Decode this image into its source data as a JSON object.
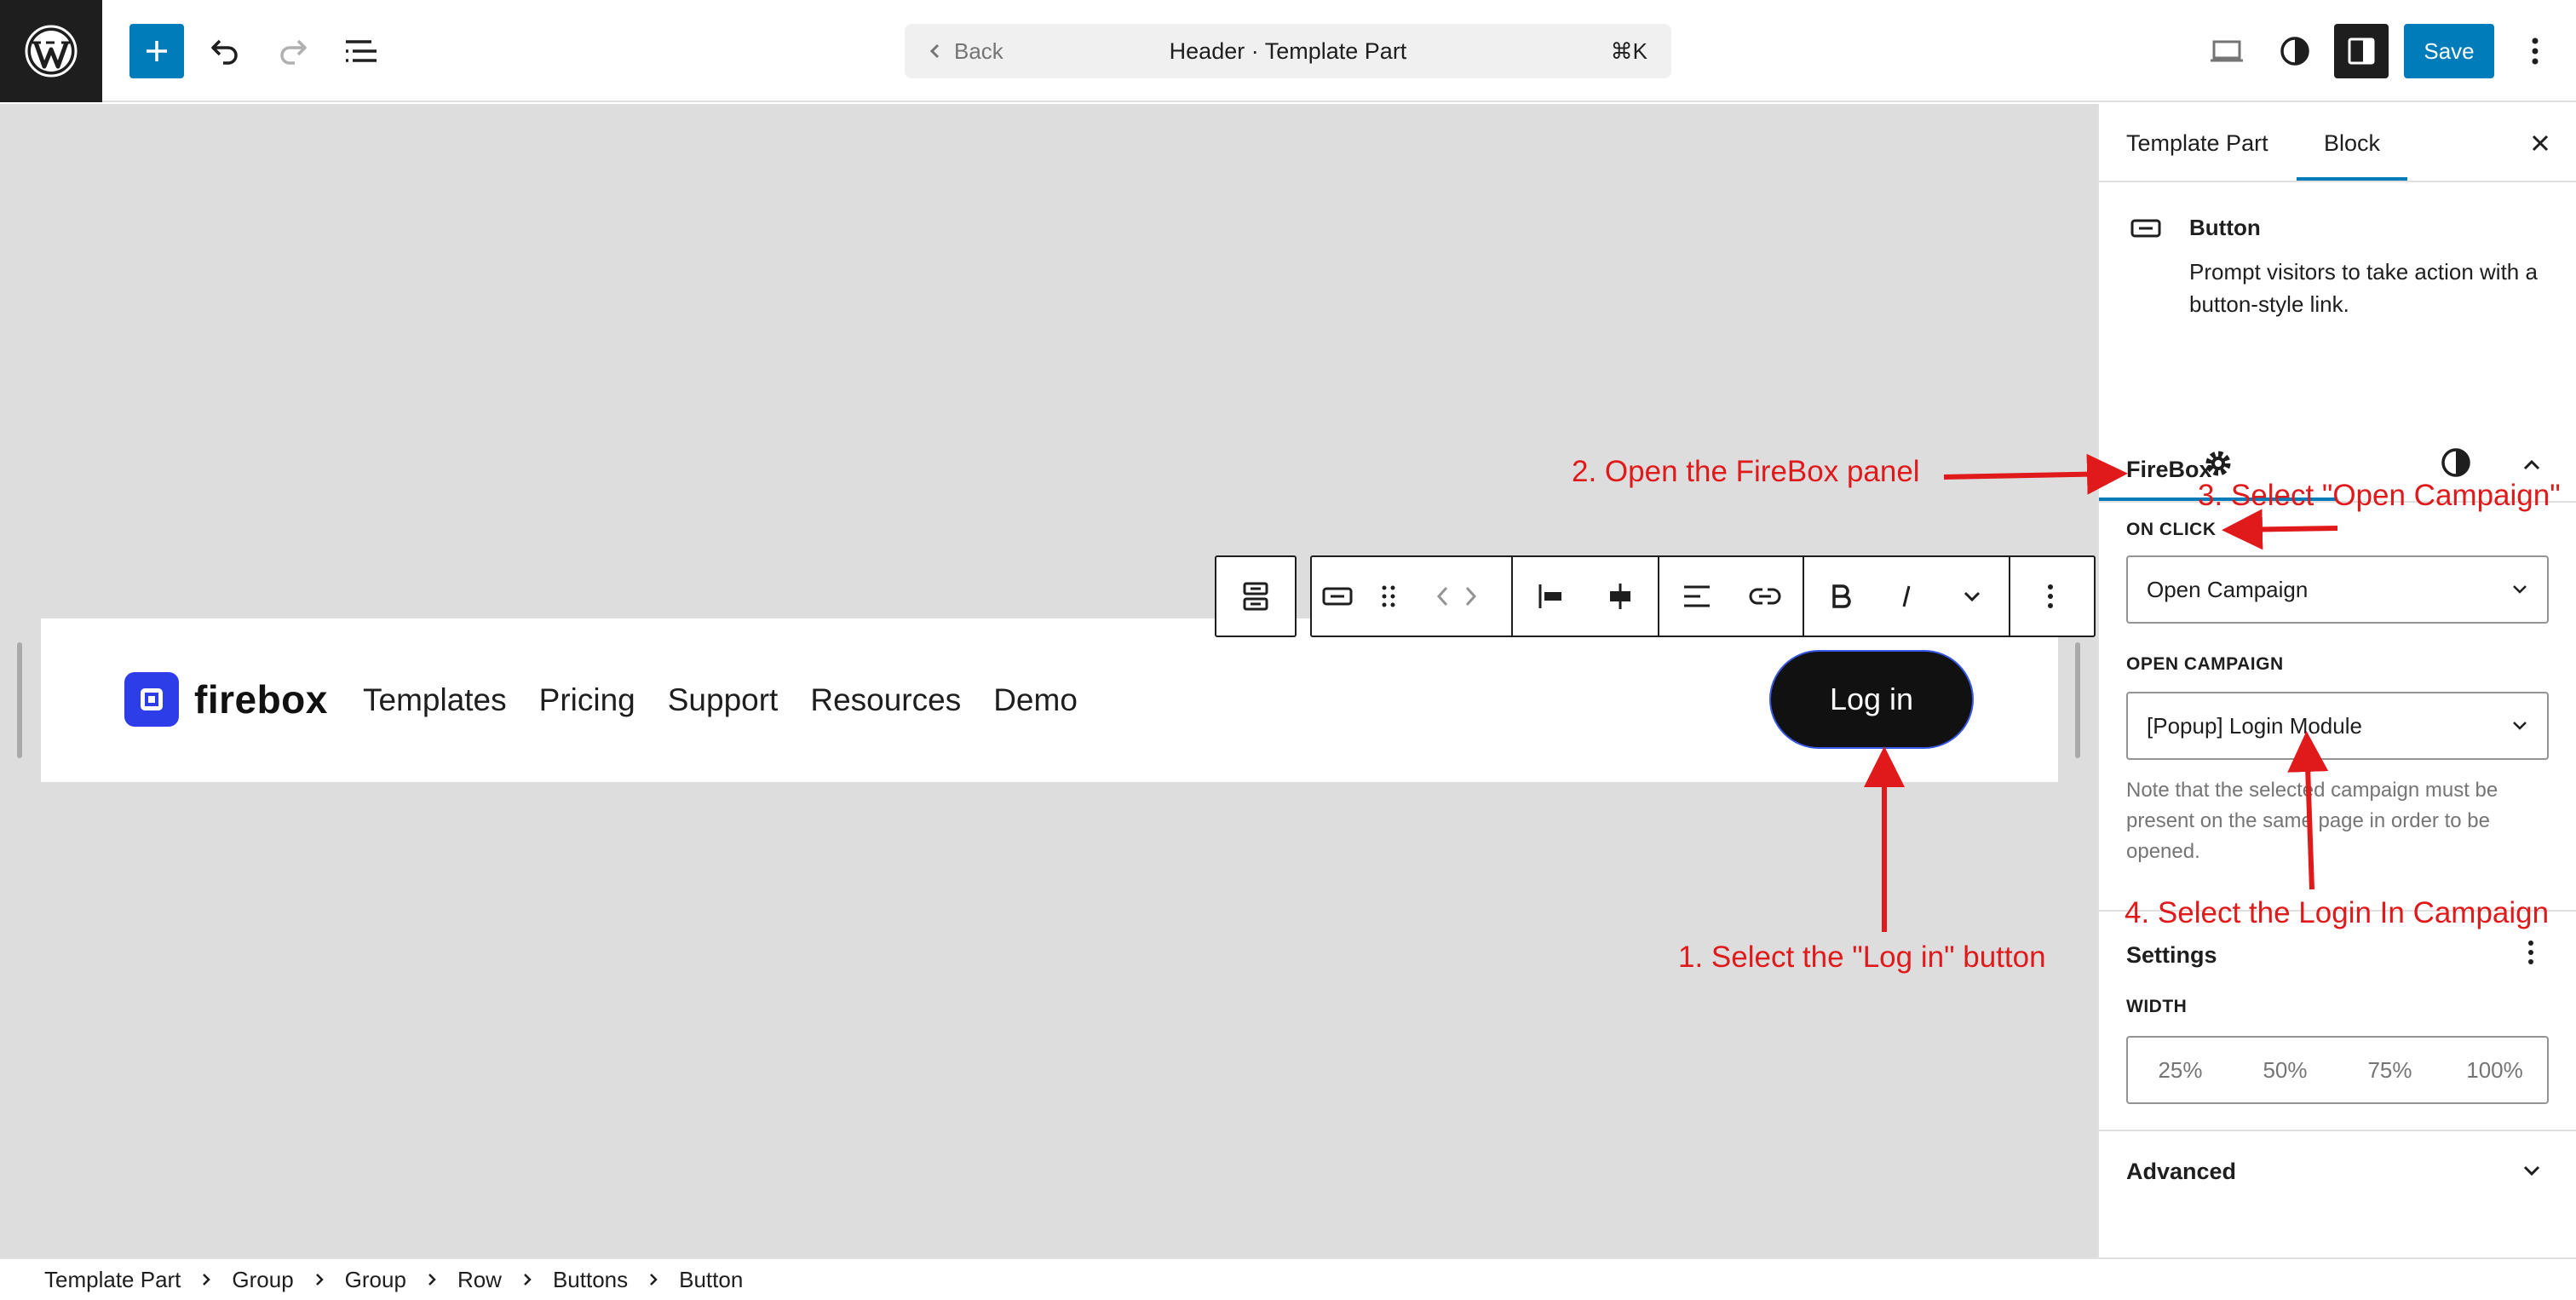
{
  "topbar": {
    "command_back": "Back",
    "command_title": "Header · Template Part",
    "command_shortcut": "⌘K",
    "save_label": "Save"
  },
  "canvas": {
    "brand_name": "firebox",
    "nav_items": [
      "Templates",
      "Pricing",
      "Support",
      "Resources",
      "Demo"
    ],
    "login_label": "Log in"
  },
  "sidebar": {
    "tabs": [
      "Template Part",
      "Block"
    ],
    "block_title": "Button",
    "block_description": "Prompt visitors to take action with a button-style link.",
    "firebox_title": "FireBox",
    "on_click_label": "ON CLICK",
    "on_click_value": "Open Campaign",
    "open_campaign_label": "OPEN CAMPAIGN",
    "open_campaign_value": "[Popup] Login Module",
    "help_text": "Note that the selected campaign must be present on the same page in order to be opened.",
    "settings_title": "Settings",
    "width_label": "WIDTH",
    "width_options": [
      "25%",
      "50%",
      "75%",
      "100%"
    ],
    "advanced_title": "Advanced"
  },
  "breadcrumb": [
    "Template Part",
    "Group",
    "Group",
    "Row",
    "Buttons",
    "Button"
  ],
  "annotations": {
    "step1": "1. Select the \"Log in\" button",
    "step2": "2. Open the FireBox panel",
    "step3": "3. Select \"Open Campaign\"",
    "step4": "4. Select the Login In Campaign"
  },
  "colors": {
    "accent": "#007cba",
    "annotation": "#e0191b",
    "brand": "#2d3ee8"
  }
}
